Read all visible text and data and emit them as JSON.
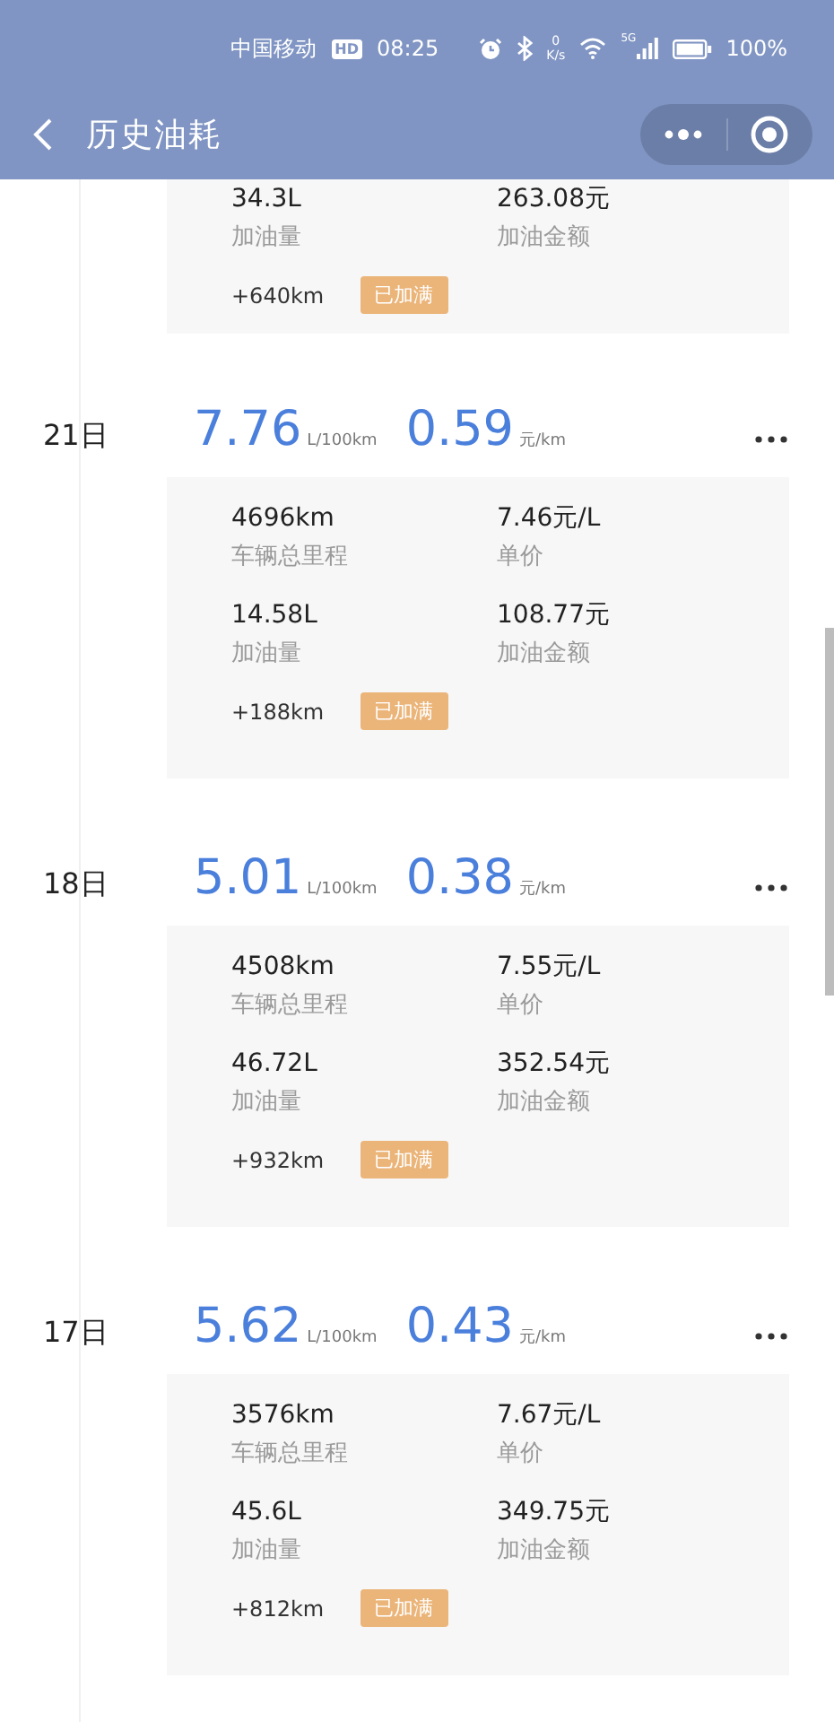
{
  "status_bar": {
    "carrier": "中国移动",
    "hd": "HD",
    "time": "08:25",
    "speed_value": "0",
    "speed_unit": "K/s",
    "network": "5G",
    "battery": "100%"
  },
  "nav": {
    "title": "历史油耗"
  },
  "partial_record": {
    "volume": "34.3L",
    "volume_label": "加油量",
    "amount": "263.08元",
    "amount_label": "加油金额",
    "distance": "+640km",
    "full_tag": "已加满"
  },
  "records": [
    {
      "day": "21日",
      "consumption": "7.76",
      "consumption_unit": "L/100km",
      "cost": "0.59",
      "cost_unit": "元/km",
      "odometer": "4696km",
      "odometer_label": "车辆总里程",
      "price": "7.46元/L",
      "price_label": "单价",
      "volume": "14.58L",
      "volume_label": "加油量",
      "amount": "108.77元",
      "amount_label": "加油金额",
      "distance": "+188km",
      "full_tag": "已加满"
    },
    {
      "day": "18日",
      "consumption": "5.01",
      "consumption_unit": "L/100km",
      "cost": "0.38",
      "cost_unit": "元/km",
      "odometer": "4508km",
      "odometer_label": "车辆总里程",
      "price": "7.55元/L",
      "price_label": "单价",
      "volume": "46.72L",
      "volume_label": "加油量",
      "amount": "352.54元",
      "amount_label": "加油金额",
      "distance": "+932km",
      "full_tag": "已加满"
    },
    {
      "day": "17日",
      "consumption": "5.62",
      "consumption_unit": "L/100km",
      "cost": "0.43",
      "cost_unit": "元/km",
      "odometer": "3576km",
      "odometer_label": "车辆总里程",
      "price": "7.67元/L",
      "price_label": "单价",
      "volume": "45.6L",
      "volume_label": "加油量",
      "amount": "349.75元",
      "amount_label": "加油金额",
      "distance": "+812km",
      "full_tag": "已加满"
    }
  ]
}
